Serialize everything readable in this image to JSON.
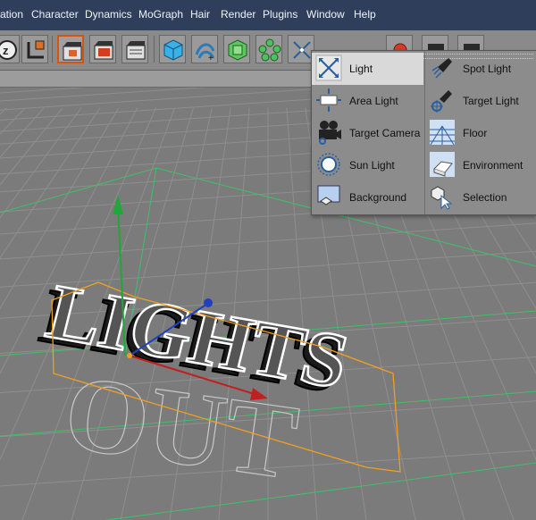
{
  "menubar": {
    "items": [
      "ation",
      "Character",
      "Dynamics",
      "MoGraph",
      "Hair",
      "Render",
      "Plugins",
      "Window",
      "Help"
    ]
  },
  "toolbar": {
    "icons": [
      "snap-icon",
      "world-axis-icon",
      "render-view-icon",
      "render-picture-viewer-icon",
      "render-settings-icon",
      "cube-icon",
      "spline-pen-icon",
      "subdivision-icon",
      "mograph-cloner-icon",
      "light-icon"
    ]
  },
  "light_menu": {
    "left": [
      {
        "label": "Light",
        "icon": "light-icon",
        "highlighted": true
      },
      {
        "label": "Area Light",
        "icon": "area-light-icon"
      },
      {
        "label": "Target Camera",
        "icon": "target-camera-icon"
      },
      {
        "label": "Sun Light",
        "icon": "sun-light-icon"
      },
      {
        "label": "Background",
        "icon": "background-icon"
      }
    ],
    "right": [
      {
        "label": "Spot Light",
        "icon": "spot-light-icon"
      },
      {
        "label": "Target Light",
        "icon": "target-light-icon"
      },
      {
        "label": "Floor",
        "icon": "floor-icon"
      },
      {
        "label": "Environment",
        "icon": "environment-icon"
      },
      {
        "label": "Selection",
        "icon": "selection-icon"
      }
    ]
  },
  "viewport": {
    "scene_text": "LIGHTS",
    "reflection_text": "OUT",
    "colors": {
      "background": "#7b7b7b",
      "grid": "#8e8e8e",
      "horizon_line": "#3fbf6a",
      "selection_outline": "#f0a020",
      "axis_y": "#1fa83a",
      "axis_x": "#c02020",
      "axis_z": "#2040c0"
    }
  }
}
